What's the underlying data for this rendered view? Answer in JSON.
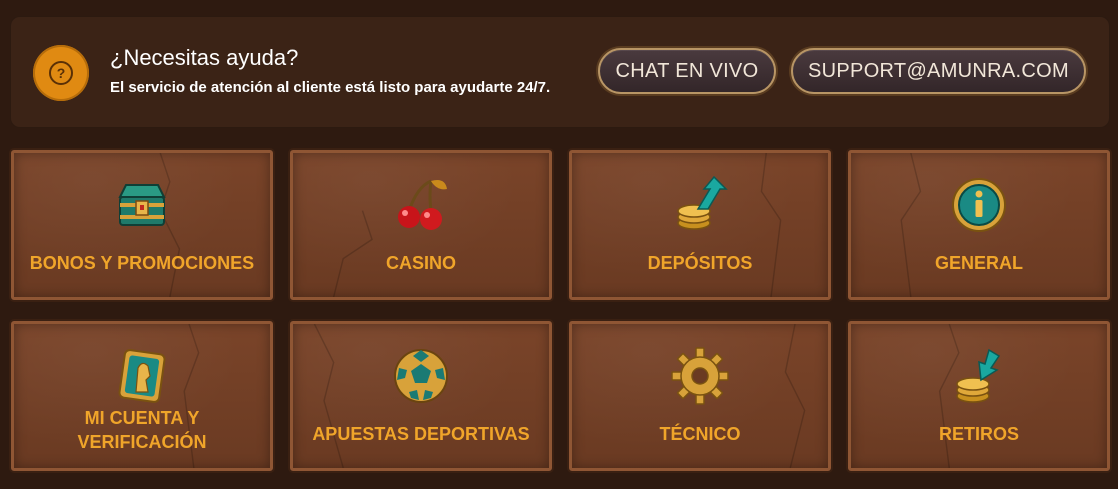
{
  "help": {
    "title": "¿Necesitas ayuda?",
    "subtitle": "El servicio de atención al cliente está listo para ayudarte 24/7.",
    "chat_label": "CHAT EN VIVO",
    "email_label": "SUPPORT@AMUNRA.COM",
    "icon": "question-icon",
    "icon_glyph": "?"
  },
  "categories": [
    {
      "label": "BONOS Y PROMOCIONES",
      "icon": "treasure-chest-icon"
    },
    {
      "label": "CASINO",
      "icon": "cherries-icon"
    },
    {
      "label": "DEPÓSITOS",
      "icon": "coins-arrow-up-icon"
    },
    {
      "label": "GENERAL",
      "icon": "info-icon"
    },
    {
      "label_line1": "MI CUENTA Y",
      "label_line2": "VERIFICACIÓN",
      "icon": "pharaoh-card-icon"
    },
    {
      "label": "APUESTAS DEPORTIVAS",
      "icon": "soccer-ball-icon"
    },
    {
      "label": "TÉCNICO",
      "icon": "gear-icon"
    },
    {
      "label": "RETIROS",
      "icon": "coins-arrow-down-icon"
    }
  ],
  "colors": {
    "background": "#2e1a10",
    "panel": "#3b2316",
    "card": "#703e25",
    "card_label": "#f0a52a",
    "help_icon": "#e08a12"
  }
}
